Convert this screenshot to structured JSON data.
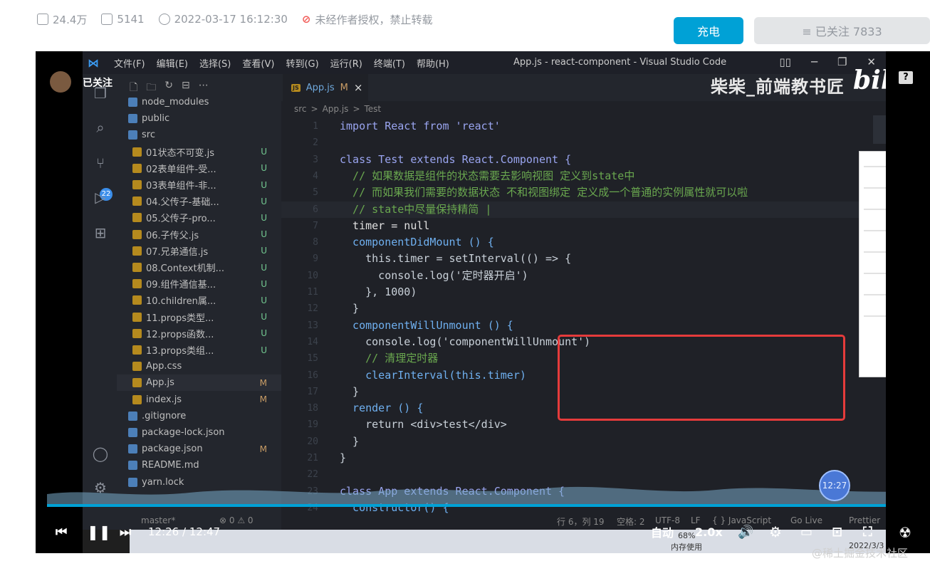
{
  "meta": {
    "plays": "24.4万",
    "danmaku": "5141",
    "datetime": "2022-03-17 16:12:30",
    "copyright": "未经作者授权，禁止转载"
  },
  "actions": {
    "charge": "充电",
    "followed": "≡ 已关注 7833"
  },
  "overlay": {
    "followed": "已关注",
    "uploader": "柴柴_前端教书匠",
    "logo": "bilibili"
  },
  "vscode": {
    "menu": [
      "文件(F)",
      "编辑(E)",
      "选择(S)",
      "查看(V)",
      "转到(G)",
      "运行(R)",
      "终端(T)",
      "帮助(H)"
    ],
    "window_title": "App.js - react-component - Visual Studio Code",
    "scm_badge": "22",
    "tab": {
      "name": "App.js",
      "modified": "M",
      "close": "×"
    },
    "breadcrumb": [
      "src",
      ">",
      "App.js",
      ">",
      "Test"
    ],
    "tree": [
      {
        "name": "node_modules",
        "status": "",
        "indent": 0
      },
      {
        "name": "public",
        "status": "",
        "indent": 0
      },
      {
        "name": "src",
        "status": "",
        "indent": 0
      },
      {
        "name": "01状态不可变.js",
        "status": "U",
        "indent": 1
      },
      {
        "name": "02表单组件-受...",
        "status": "U",
        "indent": 1
      },
      {
        "name": "03表单组件-非...",
        "status": "U",
        "indent": 1
      },
      {
        "name": "04.父传子-基础...",
        "status": "U",
        "indent": 1
      },
      {
        "name": "05.父传子-pro...",
        "status": "U",
        "indent": 1
      },
      {
        "name": "06.子传父.js",
        "status": "U",
        "indent": 1
      },
      {
        "name": "07.兄弟通信.js",
        "status": "U",
        "indent": 1
      },
      {
        "name": "08.Context机制...",
        "status": "U",
        "indent": 1
      },
      {
        "name": "09.组件通信基...",
        "status": "U",
        "indent": 1
      },
      {
        "name": "10.children属...",
        "status": "U",
        "indent": 1
      },
      {
        "name": "11.props类型...",
        "status": "U",
        "indent": 1
      },
      {
        "name": "12.props函数...",
        "status": "U",
        "indent": 1
      },
      {
        "name": "13.props类组...",
        "status": "U",
        "indent": 1
      },
      {
        "name": "App.css",
        "status": "",
        "indent": 1
      },
      {
        "name": "App.js",
        "status": "M",
        "indent": 1
      },
      {
        "name": "index.js",
        "status": "M",
        "indent": 1
      },
      {
        "name": ".gitignore",
        "status": "",
        "indent": 0
      },
      {
        "name": "package-lock.json",
        "status": "",
        "indent": 0
      },
      {
        "name": "package.json",
        "status": "M",
        "indent": 0
      },
      {
        "name": "README.md",
        "status": "",
        "indent": 0
      },
      {
        "name": "yarn.lock",
        "status": "",
        "indent": 0
      }
    ],
    "code": [
      "import React from 'react'",
      "",
      "class Test extends React.Component {",
      "  // 如果数据是组件的状态需要去影响视图 定义到state中",
      "  // 而如果我们需要的数据状态 不和视图绑定 定义成一个普通的实例属性就可以啦",
      "  // state中尽量保持精简 |",
      "  timer = null",
      "  componentDidMount () {",
      "    this.timer = setInterval(() => {",
      "      console.log('定时器开启')",
      "    }, 1000)",
      "  }",
      "  componentWillUnmount () {",
      "    console.log('componentWillUnmount')",
      "    // 清理定时器",
      "    clearInterval(this.timer)",
      "  }",
      "  render () {",
      "    return <div>test</div>",
      "  }",
      "}",
      "",
      "class App extends React.Component {",
      "  constructor() {"
    ],
    "line_numbers": [
      "1",
      "2",
      "3",
      "4",
      "5",
      "6",
      "7",
      "8",
      "9",
      "10",
      "11",
      "12",
      "13",
      "14",
      "15",
      "16",
      "17",
      "18",
      "19",
      "20",
      "21",
      "22",
      "23",
      "24"
    ],
    "status": {
      "branch": "master*",
      "errors": "⊗ 0 ⚠ 0",
      "position": "行 6，列 19",
      "spaces": "空格: 2",
      "encoding": "UTF-8",
      "eol": "LF",
      "lang": "{ } JavaScript",
      "golive": "Go Live",
      "prettier": "Prettier"
    },
    "taskbar": {
      "mem_pct": "68%",
      "mem_label": "内存使用",
      "date": "2022/3/3"
    }
  },
  "player": {
    "time_current": "12:26",
    "time_sep": "/",
    "time_total": "12:47",
    "hover_time": "12:27",
    "progress": 0.972,
    "auto": "自动",
    "speed": "2.0x"
  },
  "watermark_bottom": "@稀土掘金技术社区"
}
